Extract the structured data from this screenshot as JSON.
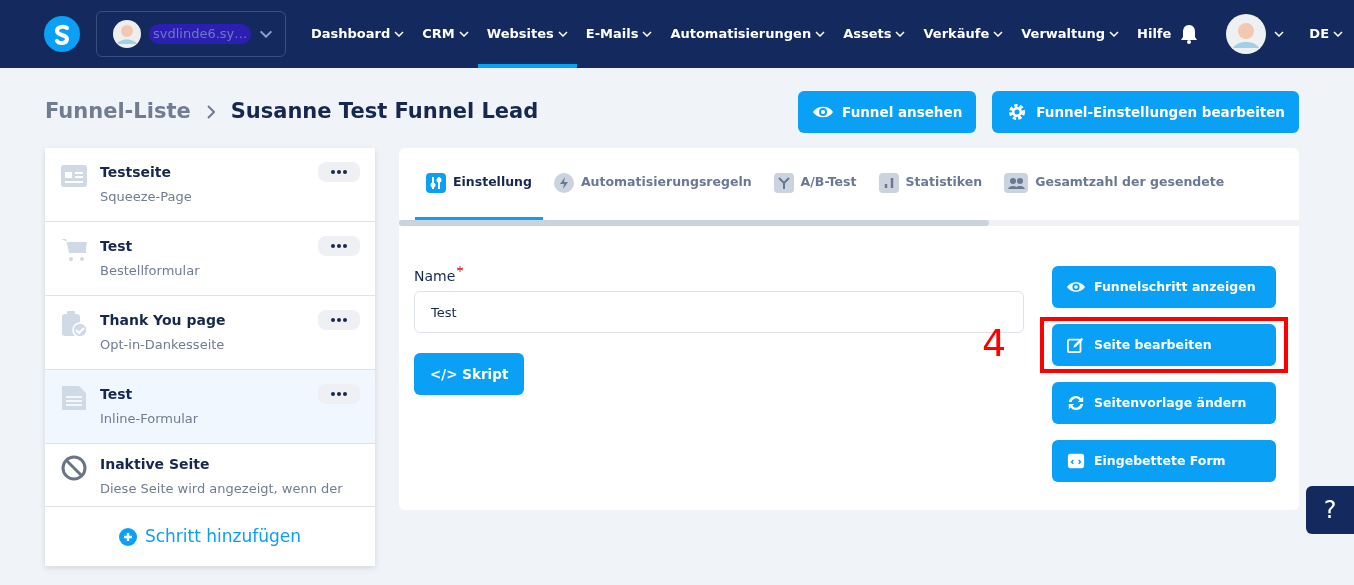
{
  "navbar": {
    "account": "svdlinde6.sy…",
    "menu": [
      {
        "label": "Dashboard",
        "selected": false
      },
      {
        "label": "CRM",
        "selected": false
      },
      {
        "label": "Websites",
        "selected": true
      },
      {
        "label": "E-Mails",
        "selected": false
      },
      {
        "label": "Automatisierungen",
        "selected": false
      },
      {
        "label": "Assets",
        "selected": false
      },
      {
        "label": "Verkäufe",
        "selected": false
      },
      {
        "label": "Verwaltung",
        "selected": false
      }
    ],
    "help": "Hilfe",
    "language": "DE"
  },
  "breadcrumb": {
    "parent": "Funnel-Liste",
    "current": "Susanne Test Funnel Lead"
  },
  "header_buttons": [
    {
      "label": "Funnel ansehen",
      "kind": "eye"
    },
    {
      "label": "Funnel-Einstellungen bearbeiten",
      "kind": "gear"
    }
  ],
  "steps": [
    {
      "title": "Testseite",
      "subtitle": "Squeeze-Page",
      "kind": "squeeze",
      "selected": false
    },
    {
      "title": "Test",
      "subtitle": "Bestellformular",
      "kind": "order",
      "selected": false
    },
    {
      "title": "Thank You page",
      "subtitle": "Opt-in-Dankesseite",
      "kind": "thankyou",
      "selected": false
    },
    {
      "title": "Test",
      "subtitle": "Inline-Formular",
      "kind": "inline",
      "selected": true
    },
    {
      "title": "Inaktive Seite",
      "subtitle": "Diese Seite wird angezeigt, wenn der",
      "kind": "inactive",
      "selected": false
    }
  ],
  "add_step": "Schritt hinzufügen",
  "tabs": [
    {
      "label": "Einstellung",
      "kind": "sliders",
      "selected": true
    },
    {
      "label": "Automatisierungsregeln",
      "kind": "bolt",
      "selected": false
    },
    {
      "label": "A/B-Test",
      "kind": "split",
      "selected": false
    },
    {
      "label": "Statistiken",
      "kind": "chart",
      "selected": false
    },
    {
      "label": "Gesamtzahl der gesendete",
      "kind": "people",
      "selected": false
    }
  ],
  "form": {
    "label": "Name",
    "required": true,
    "value": "Test",
    "script_button": "</> Skript"
  },
  "actions": [
    {
      "label": "Funnelschritt anzeigen",
      "kind": "eye",
      "highlighted": false
    },
    {
      "label": "Seite bearbeiten",
      "kind": "edit",
      "highlighted": true
    },
    {
      "label": "Seitenvorlage ändern",
      "kind": "sync",
      "highlighted": false
    },
    {
      "label": "Eingebettete Form",
      "kind": "embed",
      "highlighted": false
    }
  ],
  "annotation": "4",
  "help_button": "?"
}
